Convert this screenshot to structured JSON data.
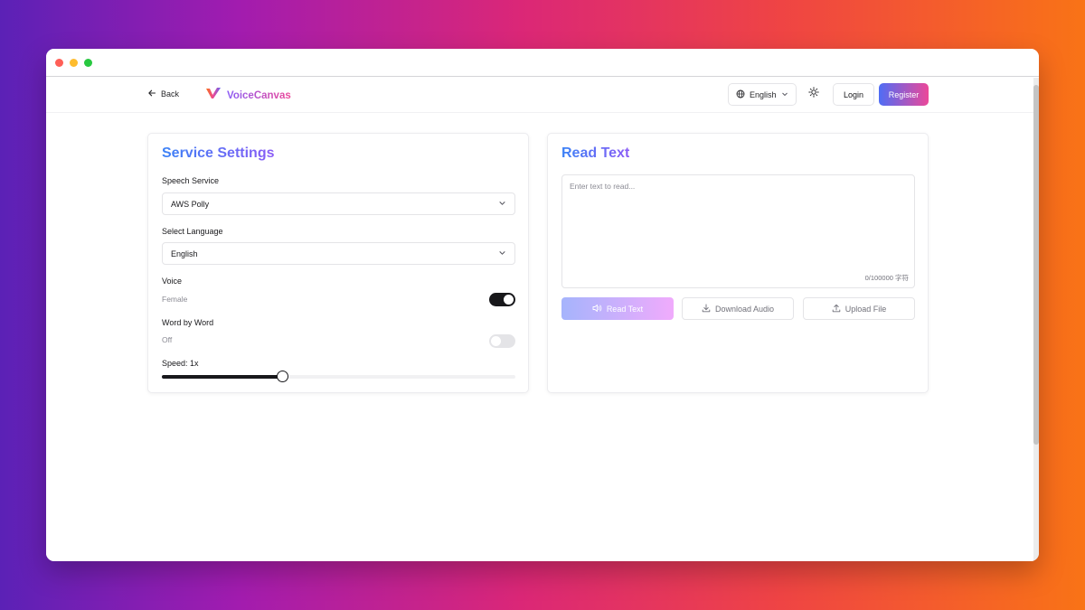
{
  "header": {
    "back_label": "Back",
    "brand_name": "VoiceCanvas",
    "language_label": "English",
    "login_label": "Login",
    "register_label": "Register"
  },
  "settings": {
    "title": "Service Settings",
    "speech_service_label": "Speech Service",
    "speech_service_value": "AWS Polly",
    "language_label": "Select Language",
    "language_value": "English",
    "voice_label": "Voice",
    "voice_value": "Female",
    "voice_toggle_on": true,
    "word_by_word_label": "Word by Word",
    "word_by_word_value": "Off",
    "word_by_word_on": false,
    "speed_label": "Speed: 1x",
    "speed_fraction": 0.34
  },
  "reader": {
    "title": "Read Text",
    "placeholder": "Enter text to read...",
    "counter": "0/100000 字符",
    "read_label": "Read Text",
    "download_label": "Download Audio",
    "upload_label": "Upload File"
  },
  "colors": {
    "accent_start": "#4f6df5",
    "accent_end": "#ec4899"
  }
}
